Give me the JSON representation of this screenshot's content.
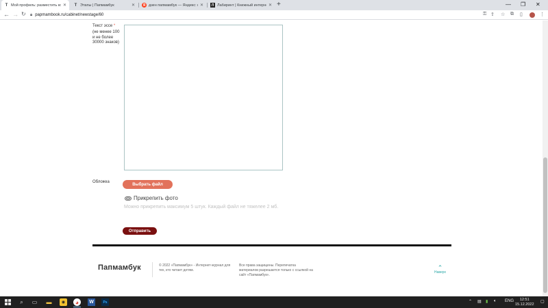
{
  "browser": {
    "tabs": [
      {
        "title": "Мой профиль: разместить конкурс",
        "active": true,
        "favicon": "Т"
      },
      {
        "title": "Этапы | Папмамбук",
        "active": false,
        "favicon": "Т"
      },
      {
        "title": "дзен папмамбук — Яндекс: нашлось",
        "active": false,
        "favicon": "Я"
      },
      {
        "title": "Лабиринт | Книжный интернет-магазин",
        "active": false,
        "favicon": "Л"
      }
    ],
    "url": "papmambook.ru/cabinet/newstage/60"
  },
  "form": {
    "essay_label": "Текст эссе",
    "required_mark": "*",
    "essay_hint": "(не менее 100 и не более 30000 знаков)",
    "essay_value": "",
    "cover_label": "Обложка",
    "choose_file_label": "Выбрать файл",
    "attach_photo_label": "Прикрепить фото",
    "attach_hint": "Можно прикрепить максимум 5 штук. Каждый файл не тяжелее 2 мб.",
    "submit_label": "Отправить"
  },
  "footer": {
    "logo": "Папмамбук",
    "copyright": "© 2022 «Папмамбук» - Интернет-журнал для тех, кто читает детям.",
    "rights": "Все права защищены. Перепечатка материалов разрешается только с ссылкой на сайт «Папмамбук».",
    "up_label": "Наверх"
  },
  "taskbar": {
    "language": "ENG",
    "time": "12:51",
    "date": "15.12.2022"
  },
  "colors": {
    "accent": "#e2725b",
    "submit": "#7a1010",
    "link": "#2aa7a7"
  }
}
